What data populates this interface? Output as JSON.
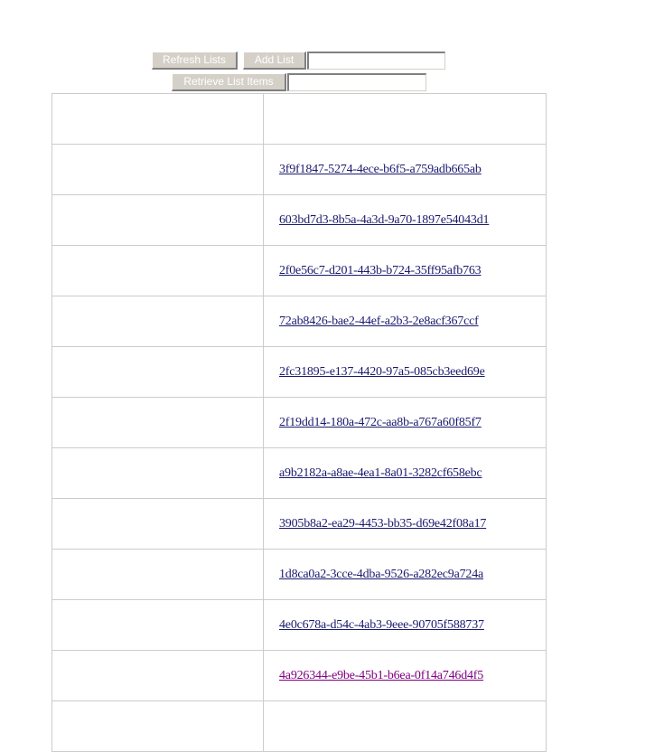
{
  "toolbar": {
    "refresh_label": "Refresh Lists",
    "add_label": "Add List",
    "add_value": "",
    "retrieve_label": "Retrieve List Items",
    "retrieve_value": ""
  },
  "grid": {
    "header": [
      "",
      ""
    ],
    "rows": [
      {
        "name": "",
        "id": "3f9f1847-5274-4ece-b6f5-a759adb665ab",
        "visited": false
      },
      {
        "name": "",
        "id": "603bd7d3-8b5a-4a3d-9a70-1897e54043d1",
        "visited": false
      },
      {
        "name": "",
        "id": "2f0e56c7-d201-443b-b724-35ff95afb763",
        "visited": false
      },
      {
        "name": "",
        "id": "72ab8426-bae2-44ef-a2b3-2e8acf367ccf",
        "visited": false
      },
      {
        "name": "",
        "id": "2fc31895-e137-4420-97a5-085cb3eed69e",
        "visited": false
      },
      {
        "name": "",
        "id": "2f19dd14-180a-472c-aa8b-a767a60f85f7",
        "visited": false
      },
      {
        "name": "",
        "id": "a9b2182a-a8ae-4ea1-8a01-3282cf658ebc",
        "visited": false
      },
      {
        "name": "",
        "id": "3905b8a2-ea29-4453-bb35-d69e42f08a17",
        "visited": false
      },
      {
        "name": "",
        "id": "1d8ca0a2-3cce-4dba-9526-a282ec9a724a",
        "visited": false
      },
      {
        "name": "",
        "id": "4e0c678a-d54c-4ab3-9eee-90705f588737",
        "visited": false
      },
      {
        "name": "",
        "id": "4a926344-e9be-45b1-b6ea-0f14a746d4f5",
        "visited": true
      },
      {
        "name": "",
        "id": "",
        "visited": false
      }
    ]
  },
  "colors": {
    "link": "#1a1a6e",
    "visited_link": "#800080",
    "grid_border": "#cccccc",
    "button_face": "#d4d0c8"
  }
}
